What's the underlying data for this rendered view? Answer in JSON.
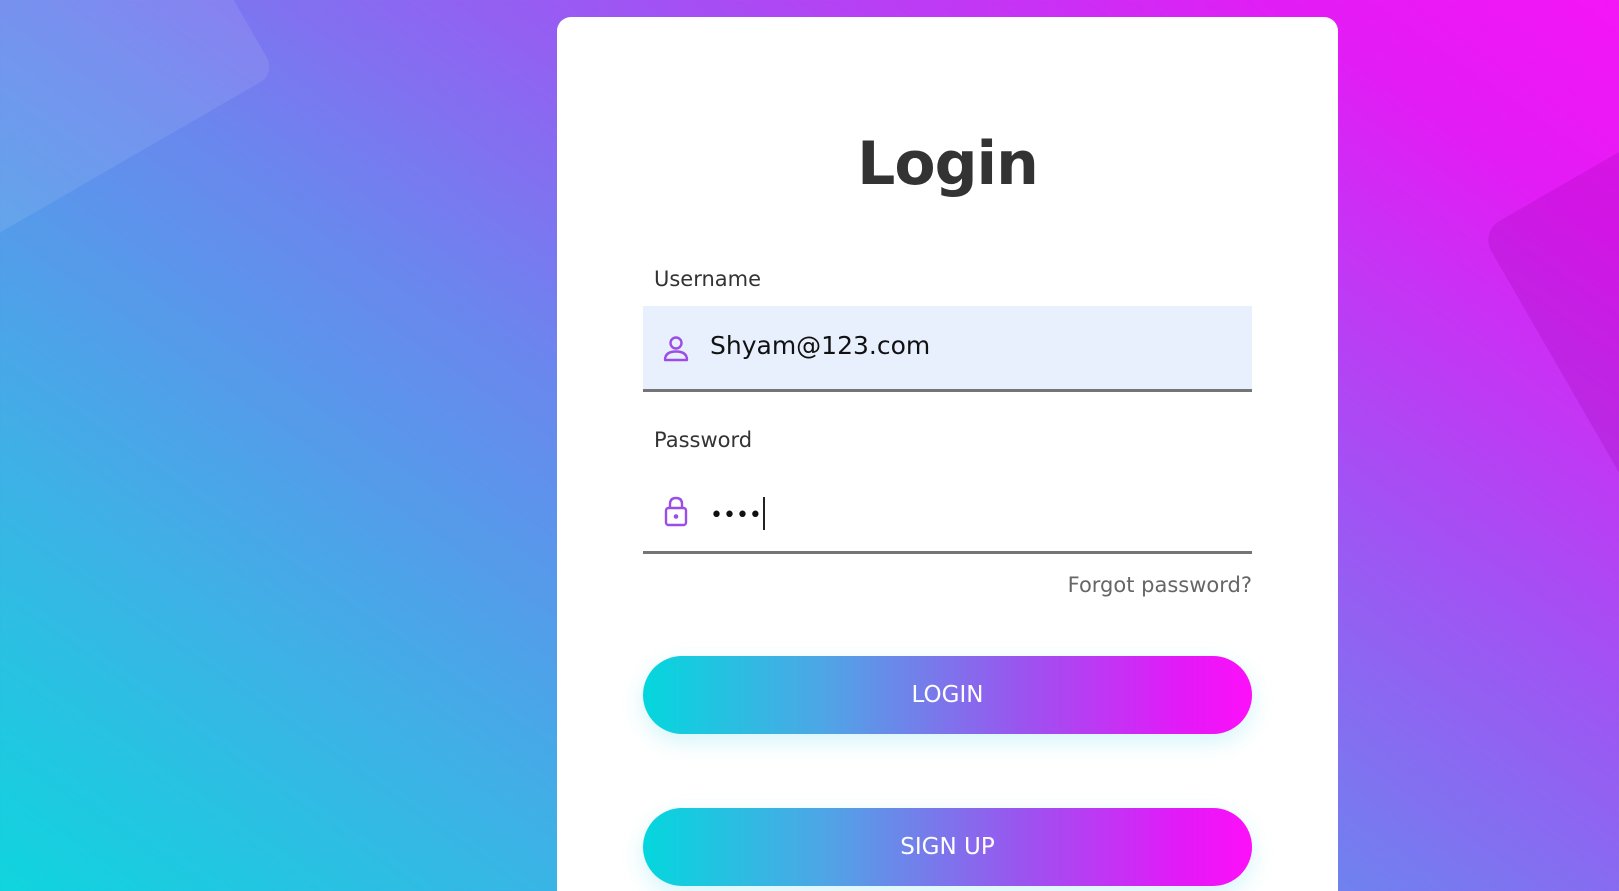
{
  "login_form": {
    "title": "Login",
    "username": {
      "label": "Username",
      "value": "Shyam@123.com",
      "icon": "user-icon"
    },
    "password": {
      "label": "Password",
      "value_masked": "••••",
      "icon": "lock-icon"
    },
    "forgot_password_label": "Forgot password?",
    "login_button_label": "LOGIN",
    "signup_button_label": "SIGN UP"
  },
  "colors": {
    "accent_purple": "#9b4de6",
    "gradient_start": "#04d7dd",
    "gradient_end": "#fd0ff9",
    "filled_input_bg": "#e8f0fe"
  }
}
